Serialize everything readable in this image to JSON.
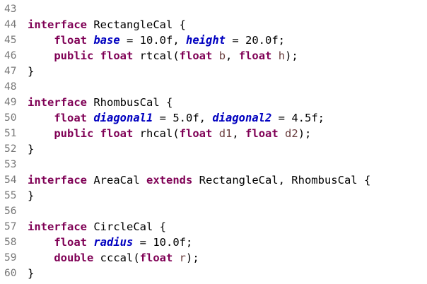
{
  "editor": {
    "lines": [
      {
        "num": "43",
        "tokens": []
      },
      {
        "num": "44",
        "tokens": [
          {
            "t": "interface",
            "c": "kw"
          },
          {
            "t": " RectangleCal {",
            "c": "tx"
          }
        ]
      },
      {
        "num": "45",
        "tokens": [
          {
            "t": "    ",
            "c": "tx"
          },
          {
            "t": "float",
            "c": "kw"
          },
          {
            "t": " ",
            "c": "tx"
          },
          {
            "t": "base",
            "c": "fld"
          },
          {
            "t": " = 10.0f, ",
            "c": "tx"
          },
          {
            "t": "height",
            "c": "fld"
          },
          {
            "t": " = 20.0f;",
            "c": "tx"
          }
        ]
      },
      {
        "num": "46",
        "tokens": [
          {
            "t": "    ",
            "c": "tx"
          },
          {
            "t": "public",
            "c": "kw"
          },
          {
            "t": " ",
            "c": "tx"
          },
          {
            "t": "float",
            "c": "kw"
          },
          {
            "t": " rtcal(",
            "c": "tx"
          },
          {
            "t": "float",
            "c": "kw"
          },
          {
            "t": " ",
            "c": "tx"
          },
          {
            "t": "b",
            "c": "prm"
          },
          {
            "t": ", ",
            "c": "tx"
          },
          {
            "t": "float",
            "c": "kw"
          },
          {
            "t": " ",
            "c": "tx"
          },
          {
            "t": "h",
            "c": "prm"
          },
          {
            "t": ");",
            "c": "tx"
          }
        ]
      },
      {
        "num": "47",
        "tokens": [
          {
            "t": "}",
            "c": "tx"
          }
        ]
      },
      {
        "num": "48",
        "tokens": []
      },
      {
        "num": "49",
        "tokens": [
          {
            "t": "interface",
            "c": "kw"
          },
          {
            "t": " RhombusCal {",
            "c": "tx"
          }
        ]
      },
      {
        "num": "50",
        "tokens": [
          {
            "t": "    ",
            "c": "tx"
          },
          {
            "t": "float",
            "c": "kw"
          },
          {
            "t": " ",
            "c": "tx"
          },
          {
            "t": "diagonal1",
            "c": "fld"
          },
          {
            "t": " = 5.0f, ",
            "c": "tx"
          },
          {
            "t": "diagonal2",
            "c": "fld"
          },
          {
            "t": " = 4.5f;",
            "c": "tx"
          }
        ]
      },
      {
        "num": "51",
        "tokens": [
          {
            "t": "    ",
            "c": "tx"
          },
          {
            "t": "public",
            "c": "kw"
          },
          {
            "t": " ",
            "c": "tx"
          },
          {
            "t": "float",
            "c": "kw"
          },
          {
            "t": " rhcal(",
            "c": "tx"
          },
          {
            "t": "float",
            "c": "kw"
          },
          {
            "t": " ",
            "c": "tx"
          },
          {
            "t": "d1",
            "c": "prm"
          },
          {
            "t": ", ",
            "c": "tx"
          },
          {
            "t": "float",
            "c": "kw"
          },
          {
            "t": " ",
            "c": "tx"
          },
          {
            "t": "d2",
            "c": "prm"
          },
          {
            "t": ");",
            "c": "tx"
          }
        ]
      },
      {
        "num": "52",
        "tokens": [
          {
            "t": "}",
            "c": "tx"
          }
        ]
      },
      {
        "num": "53",
        "tokens": []
      },
      {
        "num": "54",
        "tokens": [
          {
            "t": "interface",
            "c": "kw"
          },
          {
            "t": " AreaCal ",
            "c": "tx"
          },
          {
            "t": "extends",
            "c": "kw"
          },
          {
            "t": " RectangleCal, RhombusCal {",
            "c": "tx"
          }
        ]
      },
      {
        "num": "55",
        "tokens": [
          {
            "t": "}",
            "c": "tx"
          }
        ]
      },
      {
        "num": "56",
        "tokens": []
      },
      {
        "num": "57",
        "tokens": [
          {
            "t": "interface",
            "c": "kw"
          },
          {
            "t": " CircleCal {",
            "c": "tx"
          }
        ]
      },
      {
        "num": "58",
        "tokens": [
          {
            "t": "    ",
            "c": "tx"
          },
          {
            "t": "float",
            "c": "kw"
          },
          {
            "t": " ",
            "c": "tx"
          },
          {
            "t": "radius",
            "c": "fld"
          },
          {
            "t": " = 10.0f;",
            "c": "tx"
          }
        ]
      },
      {
        "num": "59",
        "tokens": [
          {
            "t": "    ",
            "c": "tx"
          },
          {
            "t": "double",
            "c": "kw"
          },
          {
            "t": " cccal(",
            "c": "tx"
          },
          {
            "t": "float",
            "c": "kw"
          },
          {
            "t": " ",
            "c": "tx"
          },
          {
            "t": "r",
            "c": "prm"
          },
          {
            "t": ");",
            "c": "tx"
          }
        ]
      },
      {
        "num": "60",
        "tokens": [
          {
            "t": "}",
            "c": "tx"
          }
        ]
      }
    ]
  },
  "colors": {
    "keyword": "#7f0055",
    "field": "#0000c0",
    "parameter": "#6a3e3e",
    "line_number": "#787878",
    "background": "#ffffff"
  }
}
